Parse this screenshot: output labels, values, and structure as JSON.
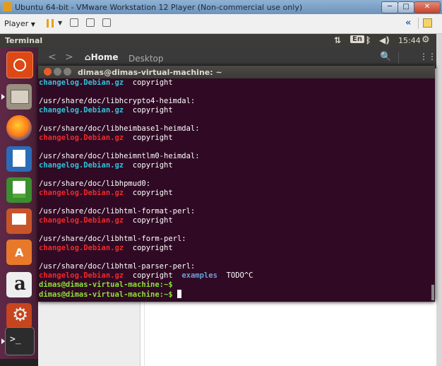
{
  "window": {
    "title": "Ubuntu 64-bit - VMware Workstation 12 Player (Non-commercial use only)",
    "min": "─",
    "max": "□",
    "close": "✕"
  },
  "vm_toolbar": {
    "player_label": "Player",
    "arrow": "▼",
    "back": "«"
  },
  "panel": {
    "title": "Terminal",
    "net": "⇅",
    "keyboard": "En",
    "bluetooth": "ᛒ",
    "volume": "◀)",
    "clock": "15:44",
    "gear": "⚙"
  },
  "nautilus": {
    "back": "<",
    "forward": ">",
    "home": "⌂Home",
    "desktop": "Desktop",
    "search": "🔍",
    "menu": "⋮⋮"
  },
  "terminal": {
    "title": "dimas@dimas-virtual-machine: ~",
    "prompt": "dimas@dimas-virtual-machine:~$",
    "entries": [
      {
        "dir": "",
        "files": [
          {
            "text": "changelog.Debian.gz",
            "color": "cyan"
          },
          {
            "text": "copyright",
            "color": "white"
          }
        ]
      },
      {
        "dir": "/usr/share/doc/libhcrypto4-heimdal:",
        "files": [
          {
            "text": "changelog.Debian.gz",
            "color": "cyan"
          },
          {
            "text": "copyright",
            "color": "white"
          }
        ]
      },
      {
        "dir": "/usr/share/doc/libheimbase1-heimdal:",
        "files": [
          {
            "text": "changelog.Debian.gz",
            "color": "red"
          },
          {
            "text": "copyright",
            "color": "white"
          }
        ]
      },
      {
        "dir": "/usr/share/doc/libheimntlm0-heimdal:",
        "files": [
          {
            "text": "changelog.Debian.gz",
            "color": "cyan"
          },
          {
            "text": "copyright",
            "color": "white"
          }
        ]
      },
      {
        "dir": "/usr/share/doc/libhpmud0:",
        "files": [
          {
            "text": "changelog.Debian.gz",
            "color": "red"
          },
          {
            "text": "copyright",
            "color": "white"
          }
        ]
      },
      {
        "dir": "/usr/share/doc/libhtml-format-perl:",
        "files": [
          {
            "text": "changelog.Debian.gz",
            "color": "red"
          },
          {
            "text": "copyright",
            "color": "white"
          }
        ]
      },
      {
        "dir": "/usr/share/doc/libhtml-form-perl:",
        "files": [
          {
            "text": "changelog.Debian.gz",
            "color": "red"
          },
          {
            "text": "copyright",
            "color": "white"
          }
        ]
      },
      {
        "dir": "/usr/share/doc/libhtml-parser-perl:",
        "files": [
          {
            "text": "changelog.Debian.gz",
            "color": "red"
          },
          {
            "text": "copyright",
            "color": "white"
          },
          {
            "text": "examples",
            "color": "blue"
          },
          {
            "text": "TODO^C",
            "color": "white"
          }
        ]
      }
    ],
    "prompt_lines": 2
  },
  "launcher": [
    {
      "name": "dash-icon",
      "id": "app-dash"
    },
    {
      "name": "files-icon",
      "id": "app-files"
    },
    {
      "name": "firefox-icon",
      "id": "app-firefox"
    },
    {
      "name": "libreoffice-writer-icon",
      "id": "app-writer"
    },
    {
      "name": "libreoffice-calc-icon",
      "id": "app-calc"
    },
    {
      "name": "libreoffice-impress-icon",
      "id": "app-impress"
    },
    {
      "name": "software-center-icon",
      "id": "app-software"
    },
    {
      "name": "amazon-icon",
      "id": "app-amazon"
    },
    {
      "name": "system-settings-icon",
      "id": "app-settings"
    },
    {
      "name": "terminal-icon",
      "id": "app-terminal"
    }
  ],
  "colors": {
    "terminal_bg": "#300a24",
    "cyan": "#2fc3d8",
    "red": "#ef2929",
    "blue": "#6a9fd8",
    "green": "#8ae234"
  }
}
